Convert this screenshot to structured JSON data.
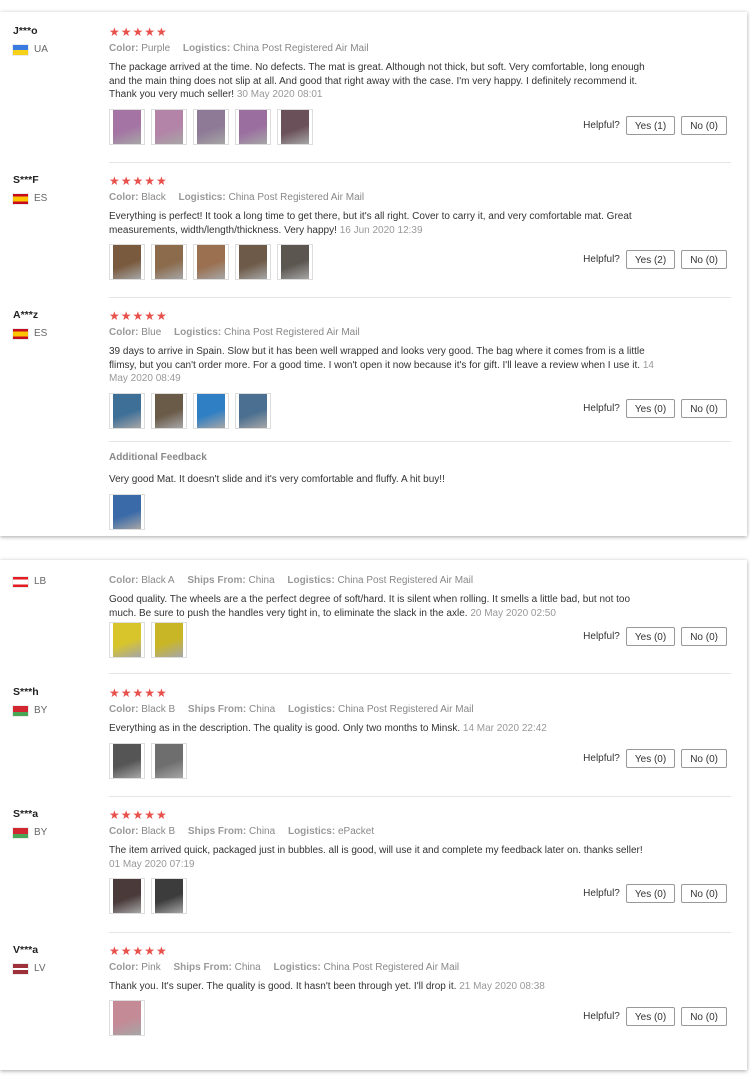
{
  "helpful_label": "Helpful?",
  "reviews_top": [
    {
      "user": "J***o",
      "country": "UA",
      "flag": "ua",
      "stars": "★★★★★",
      "color_label": "Color:",
      "color": "Purple",
      "logistics_label": "Logistics:",
      "logistics": "China Post Registered Air Mail",
      "text": "The package arrived at the time. No defects. The mat is great. Although not thick, but soft. Very comfortable, long enough and the main thing does not slip at all. And good that right away with the case. I'm very happy. I definitely recommend it. Thank you very much seller!",
      "date": "30 May 2020 08:01",
      "yes": "Yes (1)",
      "no": "No (0)",
      "thumbs": [
        "#a474a4",
        "#b483a8",
        "#8e7a96",
        "#9b6ea0",
        "#6a5058"
      ]
    },
    {
      "user": "S***F",
      "country": "ES",
      "flag": "es",
      "stars": "★★★★★",
      "color_label": "Color:",
      "color": "Black",
      "logistics_label": "Logistics:",
      "logistics": "China Post Registered Air Mail",
      "text": "Everything is perfect! It took a long time to get there, but it's all right. Cover to carry it, and very comfortable mat. Great measurements, width/length/thickness. Very happy!",
      "date": "16 Jun 2020 12:39",
      "yes": "Yes (2)",
      "no": "No (0)",
      "thumbs": [
        "#7a5a3e",
        "#8b6b4c",
        "#9a7050",
        "#6e5a48",
        "#5c5650"
      ]
    },
    {
      "user": "A***z",
      "country": "ES",
      "flag": "es",
      "stars": "★★★★★",
      "color_label": "Color:",
      "color": "Blue",
      "logistics_label": "Logistics:",
      "logistics": "China Post Registered Air Mail",
      "text": "39 days to arrive in Spain. Slow but it has been well wrapped and looks very good. The bag where it comes from is a little flimsy, but you can't order more. For a good time. I won't open it now because it's for gift. I'll leave a review when I use it.",
      "date": "14 May 2020 08:49",
      "yes": "Yes (0)",
      "no": "No (0)",
      "thumbs": [
        "#3e6f97",
        "#6a5a48",
        "#2f7fc4",
        "#4a6f90"
      ]
    }
  ],
  "additional": {
    "title": "Additional Feedback",
    "text": "Very good Mat. It doesn't slide and it's very comfortable and fluffy. A hit buy!!",
    "thumbs": [
      "#3a6aa8"
    ]
  },
  "reviews_bottom": [
    {
      "user": "",
      "country": "LB",
      "flag": "lb",
      "stars": "",
      "color_label": "Color:",
      "color": "Black A",
      "ships_label": "Ships From:",
      "ships": "China",
      "logistics_label": "Logistics:",
      "logistics": "China Post Registered Air Mail",
      "text": "Good quality. The wheels are a the perfect degree of soft/hard. It is silent when rolling. It smells a little bad, but not too much. Be sure to push the handles very tight in, to eliminate the slack in the axle.",
      "date": "20 May 2020 02:50",
      "yes": "Yes (0)",
      "no": "No (0)",
      "thumbs": [
        "#d8c52c",
        "#c9b627"
      ]
    },
    {
      "user": "S***h",
      "country": "BY",
      "flag": "by",
      "stars": "★★★★★",
      "color_label": "Color:",
      "color": "Black B",
      "ships_label": "Ships From:",
      "ships": "China",
      "logistics_label": "Logistics:",
      "logistics": "China Post Registered Air Mail",
      "text": "Everything as in the description. The quality is good. Only two months to Minsk.",
      "date": "14 Mar 2020 22:42",
      "yes": "Yes (0)",
      "no": "No (0)",
      "thumbs": [
        "#555555",
        "#6e6e6e"
      ]
    },
    {
      "user": "S***a",
      "country": "BY",
      "flag": "by",
      "stars": "★★★★★",
      "color_label": "Color:",
      "color": "Black B",
      "ships_label": "Ships From:",
      "ships": "China",
      "logistics_label": "Logistics:",
      "logistics": "ePacket",
      "text": "The item arrived quick, packaged just in bubbles. all is good, will use it and complete my feedback later on. thanks seller!",
      "date": "01 May 2020 07:19",
      "yes": "Yes (0)",
      "no": "No (0)",
      "thumbs": [
        "#4a3a3a",
        "#3c3c3c"
      ]
    },
    {
      "user": "V***a",
      "country": "LV",
      "flag": "lv",
      "stars": "★★★★★",
      "color_label": "Color:",
      "color": "Pink",
      "ships_label": "Ships From:",
      "ships": "China",
      "logistics_label": "Logistics:",
      "logistics": "China Post Registered Air Mail",
      "text": "Thank you. It's super. The quality is good. It hasn't been through yet. I'll drop it.",
      "date": "21 May 2020 08:38",
      "yes": "Yes (0)",
      "no": "No (0)",
      "thumbs": [
        "#c48a96"
      ]
    }
  ]
}
